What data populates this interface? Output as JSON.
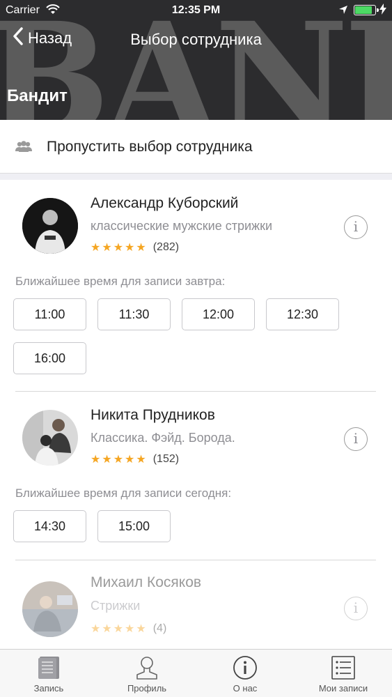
{
  "status_bar": {
    "carrier": "Carrier",
    "time": "12:35 PM"
  },
  "nav": {
    "back_label": "Назад",
    "title": "Выбор сотрудника",
    "company": "Бандит",
    "bg_text": "BANDIT"
  },
  "skip": {
    "label": "Пропустить выбор сотрудника"
  },
  "employees": [
    {
      "name": "Александр Куборский",
      "description": "классические мужские стрижки",
      "stars": "★★★★★",
      "reviews": "(282)",
      "slots_label": "Ближайшее время для записи завтра:",
      "slots": [
        "11:00",
        "11:30",
        "12:00",
        "12:30",
        "16:00"
      ]
    },
    {
      "name": "Никита Прудников",
      "description": "Классика. Фэйд. Борода.",
      "stars": "★★★★★",
      "reviews": "(152)",
      "slots_label": "Ближайшее время для записи сегодня:",
      "slots": [
        "14:30",
        "15:00"
      ]
    },
    {
      "name": "Михаил Косяков",
      "description": "Стрижки",
      "stars": "★★★★★",
      "reviews": "(4)"
    }
  ],
  "tabs": [
    {
      "label": "Запись",
      "icon": "book-icon"
    },
    {
      "label": "Профиль",
      "icon": "person-icon"
    },
    {
      "label": "О нас",
      "icon": "info-icon"
    },
    {
      "label": "Мои записи",
      "icon": "list-icon"
    }
  ],
  "colors": {
    "accent_star": "#f5a623",
    "header_bg": "#2c2c2e",
    "battery": "#4cd964"
  }
}
